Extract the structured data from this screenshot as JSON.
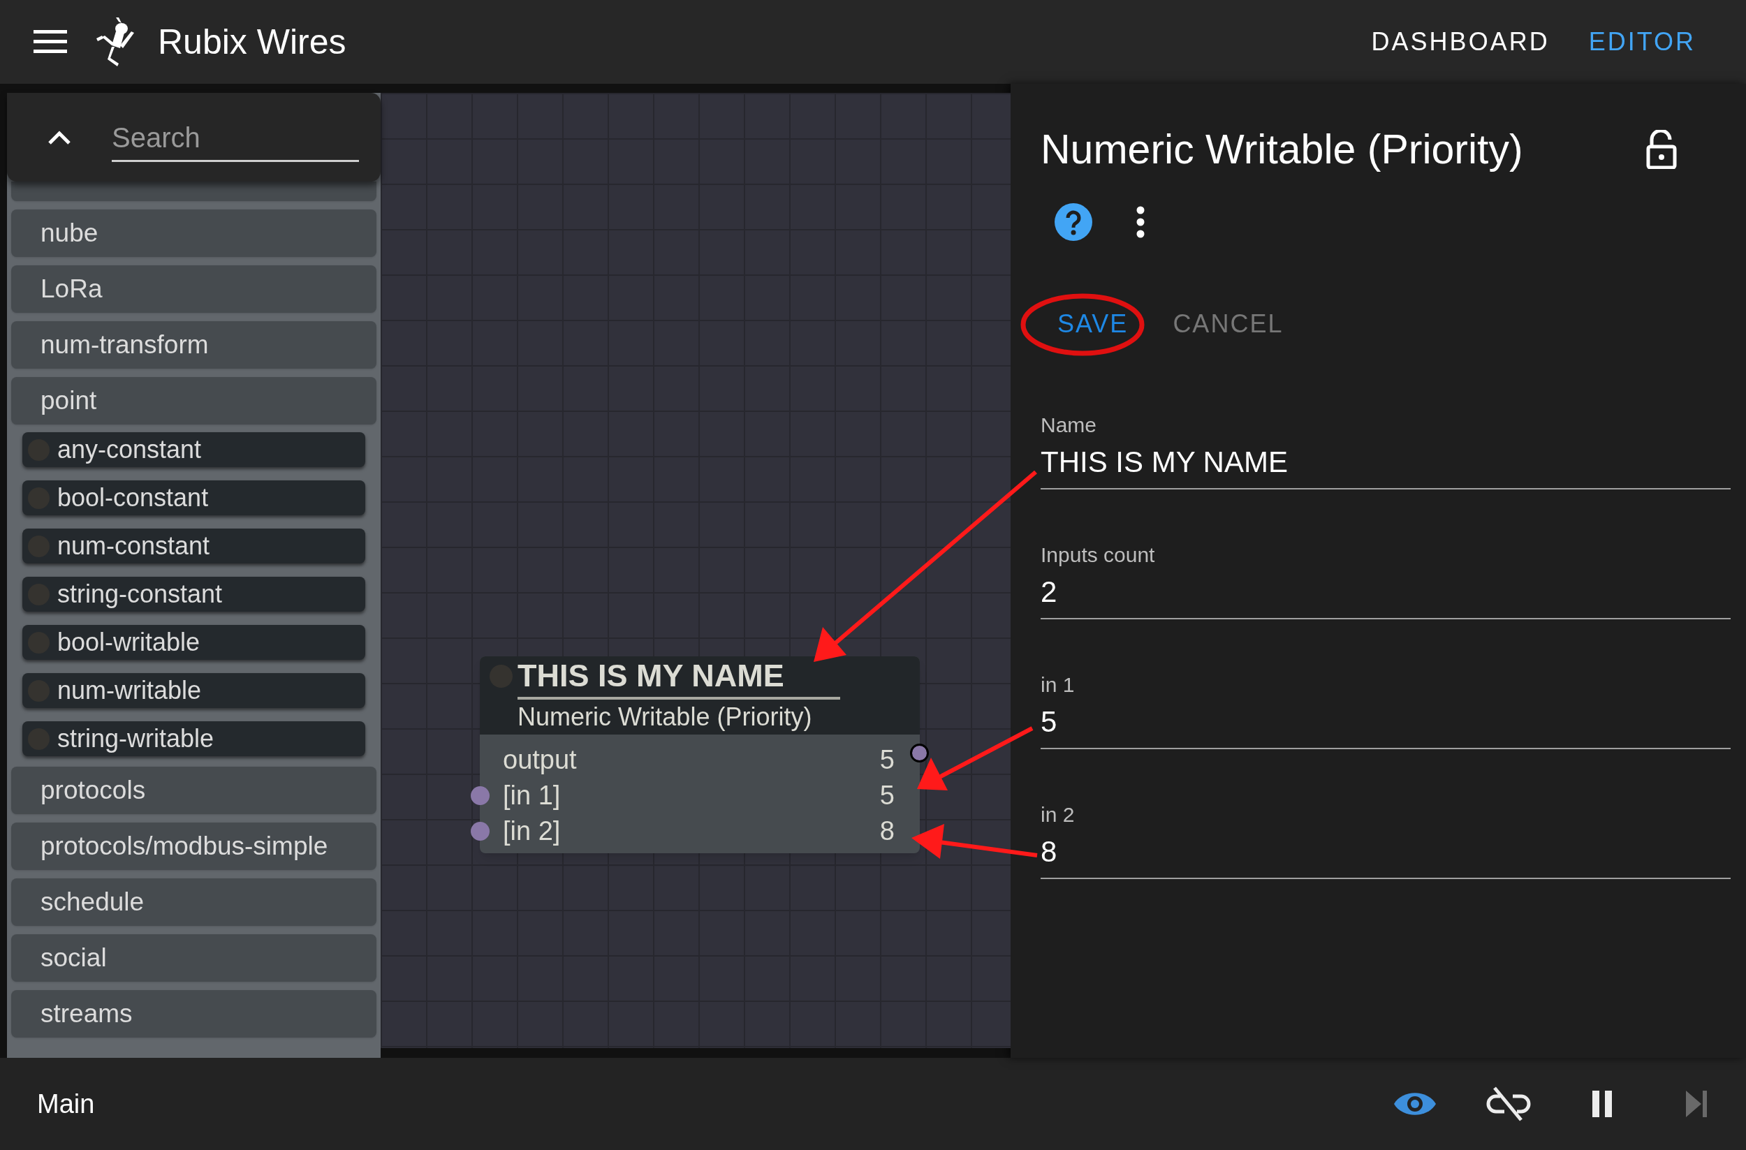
{
  "header": {
    "title": "Rubix Wires",
    "nav": [
      {
        "label": "DASHBOARD",
        "selected": false
      },
      {
        "label": "EDITOR",
        "selected": true
      }
    ]
  },
  "palette": {
    "search": {
      "placeholder": "Search"
    },
    "groups": [
      {
        "label": "nube"
      },
      {
        "label": "LoRa"
      },
      {
        "label": "num-transform"
      },
      {
        "label": "point",
        "children": [
          {
            "label": "any-constant"
          },
          {
            "label": "bool-constant"
          },
          {
            "label": "num-constant"
          },
          {
            "label": "string-constant"
          },
          {
            "label": "bool-writable"
          },
          {
            "label": "num-writable"
          },
          {
            "label": "string-writable"
          }
        ]
      },
      {
        "label": "protocols"
      },
      {
        "label": "protocols/modbus-simple"
      },
      {
        "label": "schedule"
      },
      {
        "label": "social"
      },
      {
        "label": "streams"
      }
    ]
  },
  "node": {
    "title": "THIS IS MY NAME",
    "type": "Numeric Writable (Priority)",
    "ports": [
      {
        "label": "output",
        "value": "5",
        "kind": "output"
      },
      {
        "label": "[in 1]",
        "value": "5",
        "kind": "input"
      },
      {
        "label": "[in 2]",
        "value": "8",
        "kind": "input"
      }
    ]
  },
  "inspector": {
    "title": "Numeric Writable (Priority)",
    "buttons": [
      {
        "label": "SAVE",
        "kind": "primary"
      },
      {
        "label": "CANCEL",
        "kind": "secondary"
      }
    ],
    "fields": [
      {
        "label": "Name",
        "value": "THIS IS MY NAME"
      },
      {
        "label": "Inputs count",
        "value": "2"
      },
      {
        "label": "in 1",
        "value": "5"
      },
      {
        "label": "in 2",
        "value": "8"
      }
    ]
  },
  "status_bar": {
    "tab": "Main",
    "controls": [
      {
        "kind": "eye",
        "active": true,
        "disabled": false
      },
      {
        "kind": "link-off",
        "active": false,
        "disabled": false
      },
      {
        "kind": "pause",
        "active": false,
        "disabled": false
      },
      {
        "kind": "step",
        "active": false,
        "disabled": true
      }
    ]
  }
}
